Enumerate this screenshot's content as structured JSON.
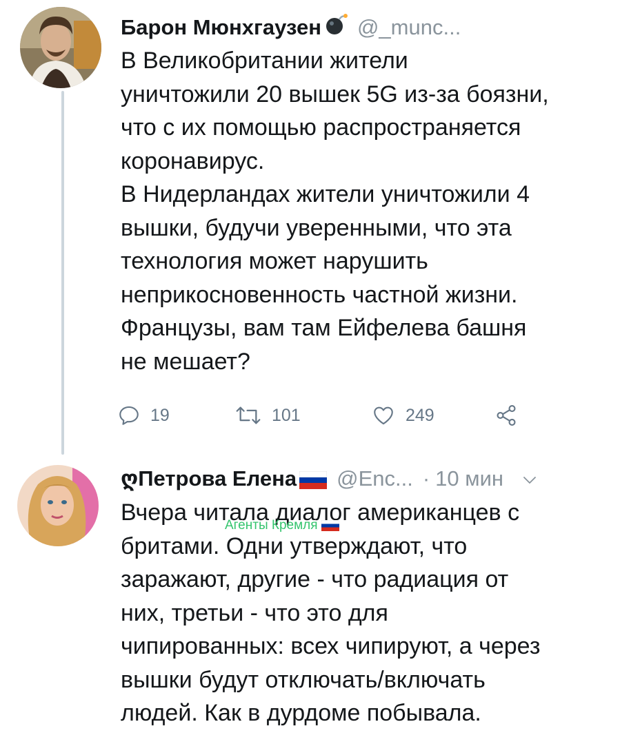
{
  "thread": {
    "tweet1": {
      "author_name": "Барон Мюнхгаузен",
      "author_emoji": "bomb-icon",
      "handle": "@_munc...",
      "text": "В Великобритании жители\nуничтожили 20 вышек 5G из-за боязни,\nчто с их помощью распространяется\nкоронавирус.\nВ Нидерландах жители уничтожили 4\nвышки, будучи уверенными, что эта\nтехнология может нарушить\nнеприкосновенность частной жизни.\nФранцузы, вам там Ейфелева башня\nне мешает?",
      "actions": {
        "reply_count": "19",
        "retweet_count": "101",
        "like_count": "249"
      }
    },
    "tweet2": {
      "author_name": "Петрова Елена",
      "author_prefix_glyph": "ღ",
      "author_flag": "russia-flag-icon",
      "handle": "@Enc...",
      "separator": "·",
      "time": "10 мин",
      "text": "Вчера читала диалог американцев с\nбритами. Одни утверждают, что\nзаражают, другие - что радиация от\nних, третьи - что это для\nчипированных: всех чипируют, а через\nвышки будут отключать/включать\nлюдей. Как в дурдоме побывала.",
      "overlay_label": "Агенты Кремля"
    }
  },
  "colors": {
    "text": "#14171a",
    "secondary": "#8a949c",
    "action": "#667787",
    "thread_line": "#ccd6dd",
    "overlay_green": "#34c46d",
    "flag_white": "#ffffff",
    "flag_blue": "#0039a6",
    "flag_red": "#d52b1e"
  }
}
